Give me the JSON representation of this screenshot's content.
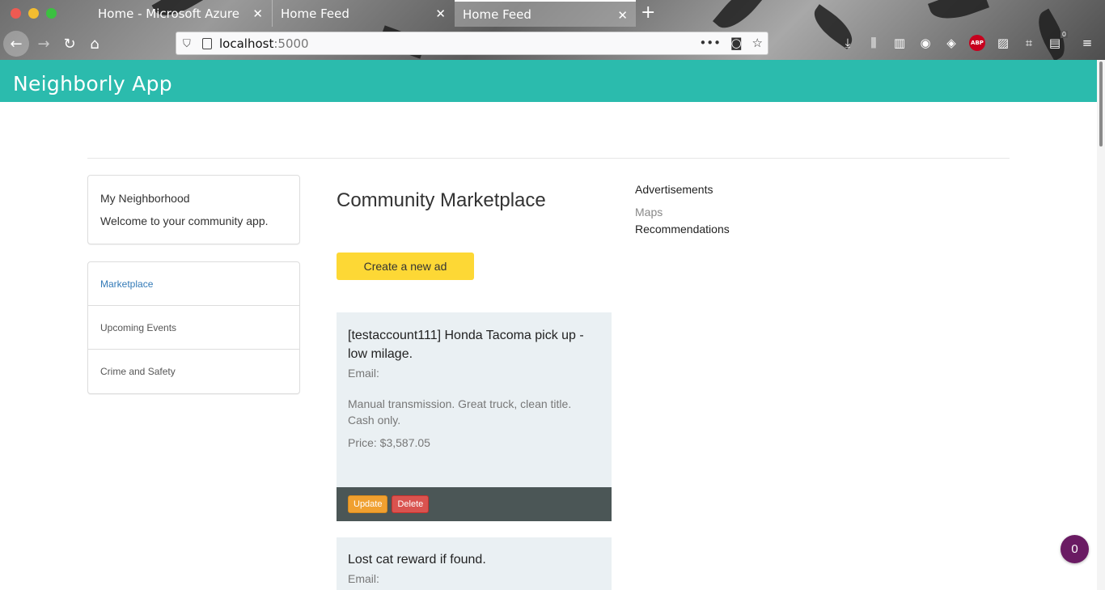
{
  "browser": {
    "tabs": [
      {
        "label": "Home - Microsoft Azure"
      },
      {
        "label": "Home Feed"
      },
      {
        "label": "Home Feed",
        "active": true
      }
    ],
    "url_host": "localhost",
    "url_port": ":5000",
    "toolbar_badge": "0"
  },
  "app": {
    "title": "Neighborly App"
  },
  "sidebar": {
    "intro_title": "My Neighborhood",
    "intro_text": "Welcome to your community app.",
    "items": [
      {
        "label": "Marketplace",
        "active": true
      },
      {
        "label": "Upcoming Events"
      },
      {
        "label": "Crime and Safety"
      }
    ]
  },
  "main": {
    "title": "Community Marketplace",
    "create_label": "Create a new ad",
    "ads": [
      {
        "title": "[testaccount111] Honda Tacoma pick up - low milage.",
        "email": "Email:",
        "description": "Manual transmission. Great truck, clean title. Cash only.",
        "price": "Price: $3,587.05",
        "update_label": "Update",
        "delete_label": "Delete"
      },
      {
        "title": "Lost cat reward if found.",
        "email": "Email:"
      }
    ]
  },
  "aside": {
    "title": "Advertisements",
    "maps": "Maps",
    "recommendations": "Recommendations"
  },
  "notification_count": "0",
  "colors": {
    "header": "#2bbbad",
    "create_button": "#fdd835",
    "card_bg": "#eaf0f3",
    "card_footer": "#4b5656",
    "update_button": "#f0a030",
    "delete_button": "#d9534f",
    "badge": "#6a1b63"
  }
}
